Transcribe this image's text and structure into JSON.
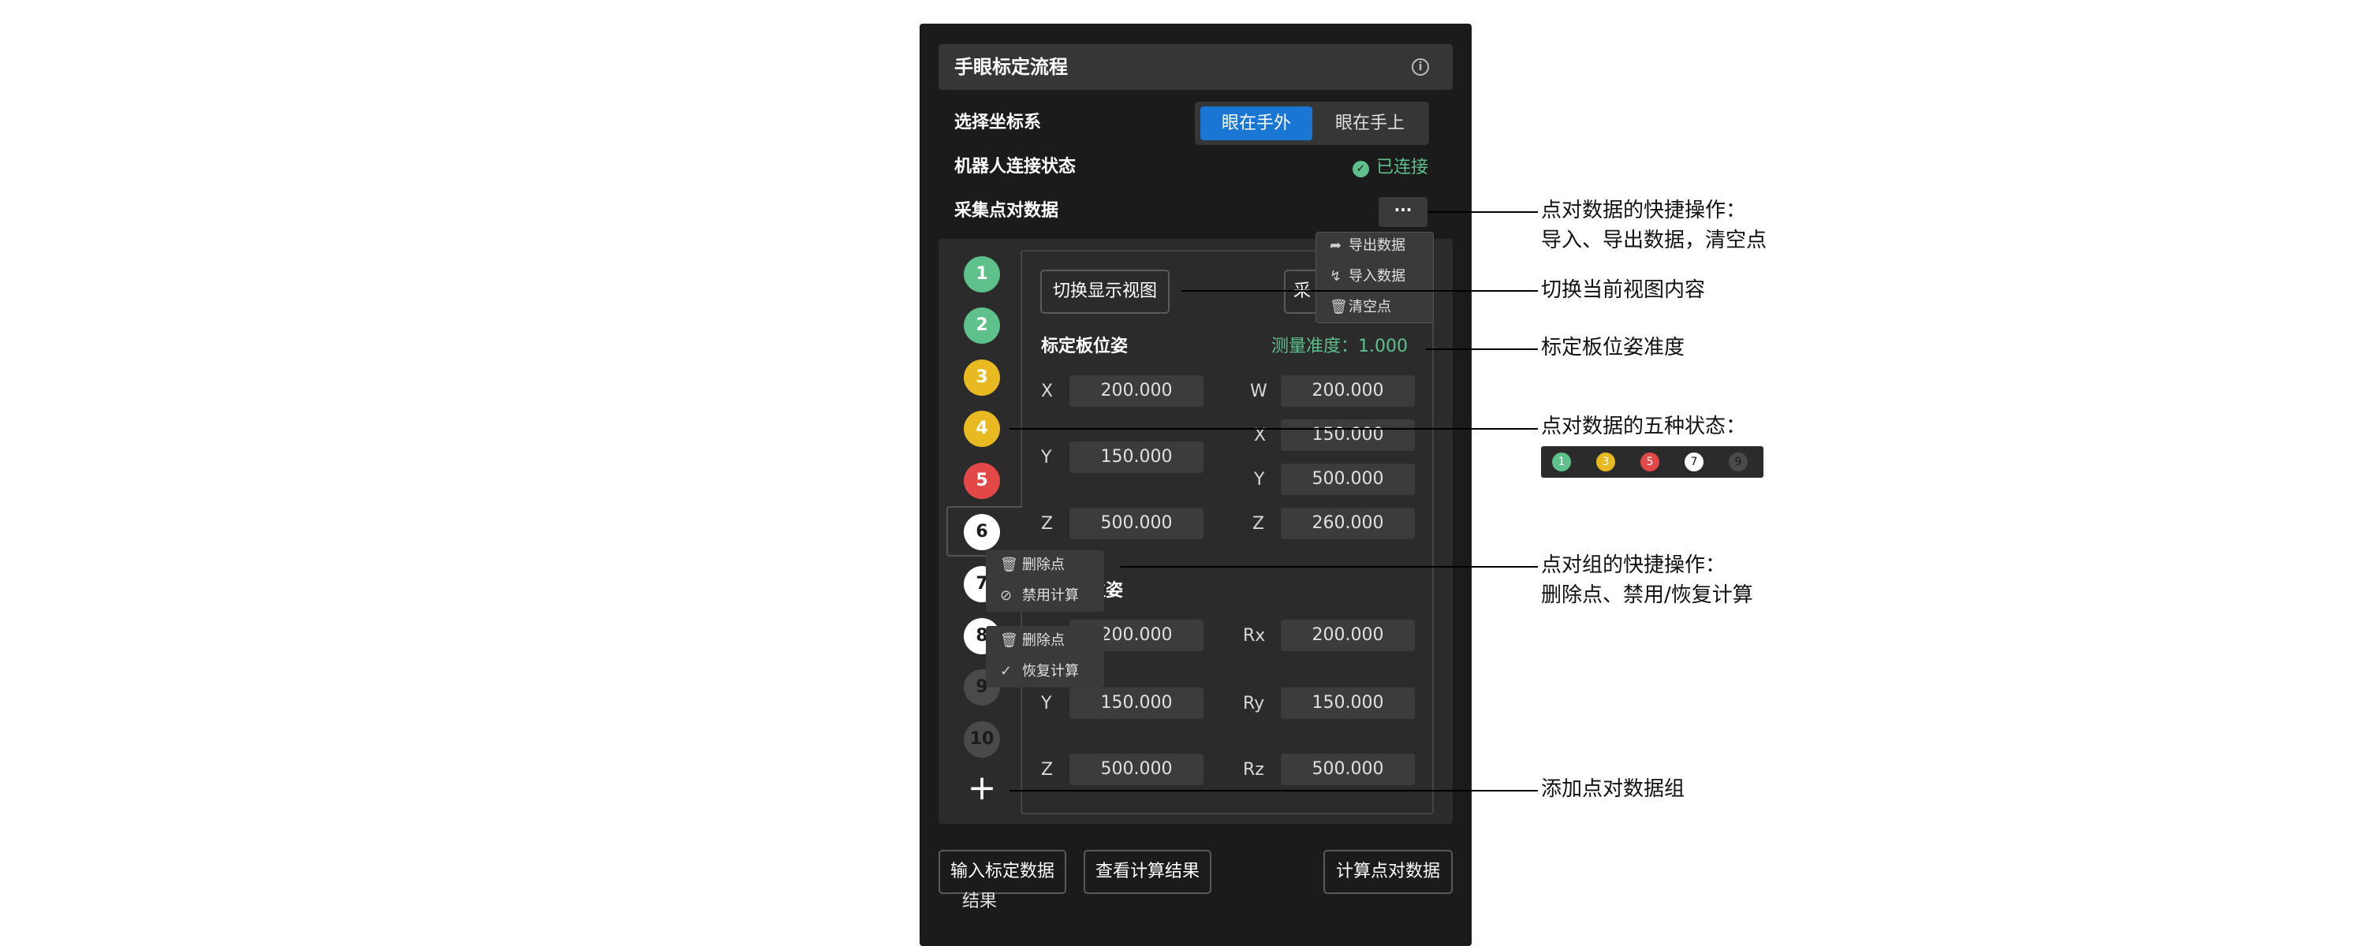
{
  "panel": {
    "title": "手眼标定流程",
    "info_icon": "info-icon",
    "coord_label": "选择坐标系",
    "coord_options": [
      "眼在手外",
      "眼在手上"
    ],
    "robot_label": "机器人连接状态",
    "robot_status": "已连接",
    "collect_label": "采集点对数据",
    "more_label": "···"
  },
  "menu": {
    "items": [
      {
        "icon": "share-icon",
        "label": "导出数据"
      },
      {
        "icon": "import-icon",
        "label": "导入数据"
      },
      {
        "icon": "trash-icon",
        "label": "清空点"
      }
    ]
  },
  "view": {
    "switch_label": "切换显示视图",
    "collect_partial": "采",
    "board_title": "标定板位姿",
    "accuracy": "测量准度：1.000",
    "board_fields": [
      {
        "label": "X",
        "value": "200.000"
      },
      {
        "label": "W",
        "value": "200.000"
      },
      {
        "label": "X",
        "value": "150.000"
      },
      {
        "label": "Y",
        "value": "150.000"
      },
      {
        "label": "Y",
        "value": "500.000"
      },
      {
        "label": "Z",
        "value": "500.000"
      },
      {
        "label": "Z",
        "value": "260.000"
      }
    ],
    "second_title_partial": "位姿",
    "pose_fields": [
      {
        "label": "X",
        "value": "200.000"
      },
      {
        "label": "Rx",
        "value": "200.000"
      },
      {
        "label": "Y",
        "value": "150.000"
      },
      {
        "label": "Ry",
        "value": "150.000"
      },
      {
        "label": "Z",
        "value": "500.000"
      },
      {
        "label": "Rz",
        "value": "500.000"
      }
    ]
  },
  "points": [
    {
      "label": "1",
      "state": "green"
    },
    {
      "label": "2",
      "state": "green"
    },
    {
      "label": "3",
      "state": "yellow"
    },
    {
      "label": "4",
      "state": "yellow"
    },
    {
      "label": "5",
      "state": "red"
    },
    {
      "label": "6",
      "state": "white"
    },
    {
      "label": "7",
      "state": "white"
    },
    {
      "label": "8",
      "state": "white"
    },
    {
      "label": "9",
      "state": "disabled"
    },
    {
      "label": "10",
      "state": "disabled"
    }
  ],
  "group_menu_1": {
    "delete": "删除点",
    "disable": "禁用计算"
  },
  "group_menu_2": {
    "delete": "删除点",
    "restore": "恢复计算"
  },
  "bottom": {
    "input_btn": "输入标定数据",
    "view_btn": "查看计算结果",
    "calc_btn": "计算点对数据",
    "result_label": "结果"
  },
  "annotations": {
    "a1_line1": "点对数据的快捷操作：",
    "a1_line2": "导入、导出数据，清空点",
    "a2": "切换当前视图内容",
    "a3": "标定板位姿准度",
    "a4": "点对数据的五种状态：",
    "a5_line1": "点对组的快捷操作：",
    "a5_line2": "删除点、禁用/恢复计算",
    "a6": "添加点对数据组"
  },
  "legend": [
    {
      "label": "1",
      "state": "green"
    },
    {
      "label": "3",
      "state": "yellow"
    },
    {
      "label": "5",
      "state": "red"
    },
    {
      "label": "7",
      "state": "white"
    },
    {
      "label": "9",
      "state": "disabled"
    }
  ],
  "colors": {
    "accent": "#1976d2",
    "success": "#5ec08a",
    "green": "#5ec08a",
    "yellow": "#e8b921",
    "red": "#e24848",
    "white": "#ffffff",
    "disabled": "#4a4a4a"
  }
}
